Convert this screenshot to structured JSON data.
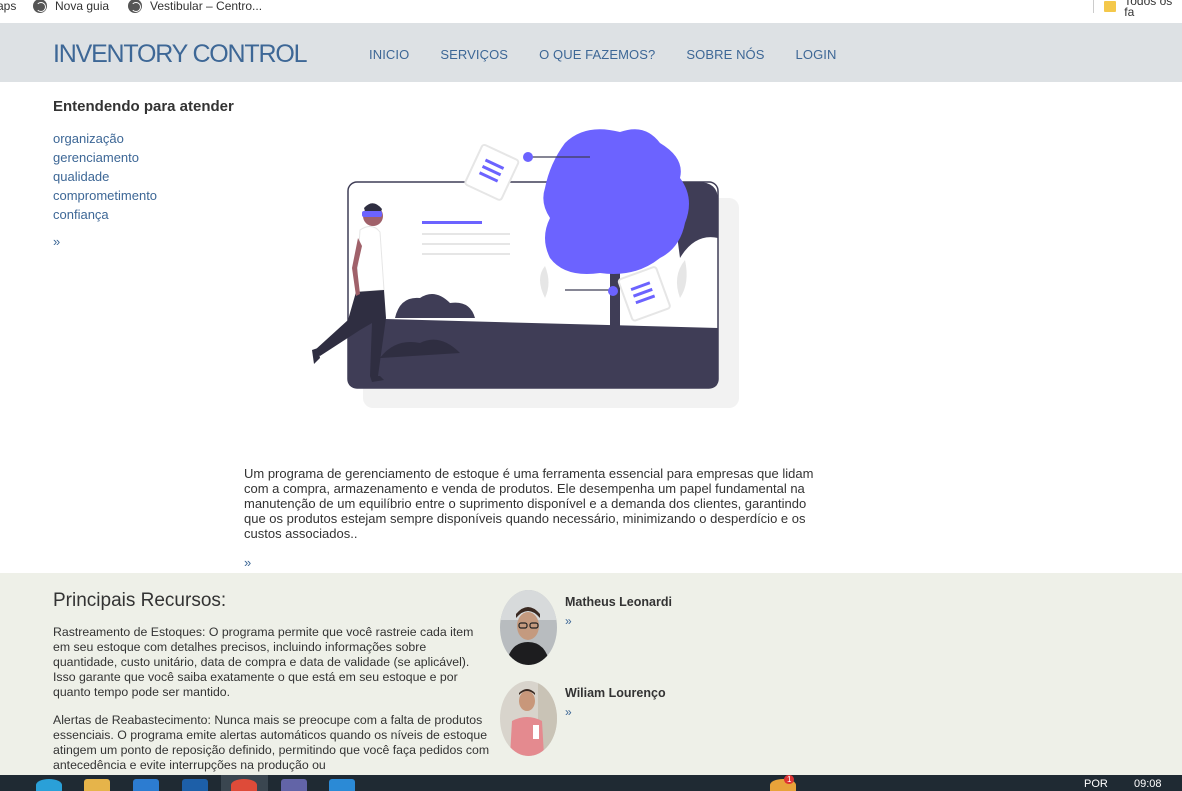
{
  "bookmarks": [
    {
      "label": "aps",
      "icon": "none"
    },
    {
      "label": "Nova guia",
      "icon": "globe-icon"
    },
    {
      "label": "Vestibular – Centro...",
      "icon": "globe-icon"
    },
    {
      "label": "Todos os fa",
      "icon": "folder-icon"
    }
  ],
  "header": {
    "brand": "INVENTORY CONTROL",
    "nav": [
      "INICIO",
      "SERVIÇOS",
      "O QUE FAZEMOS?",
      "SOBRE NÓS",
      "LOGIN"
    ]
  },
  "sidebar": {
    "title": "Entendendo para atender",
    "items": [
      "organização",
      "gerenciamento",
      "qualidade",
      "comprometimento",
      "confiança"
    ],
    "more": "»"
  },
  "main": {
    "description": "Um programa de gerenciamento de estoque é uma ferramenta essencial para empresas que lidam com a compra, armazenamento e venda de produtos. Ele desempenha um papel fundamental na manutenção de um equilíbrio entre o suprimento disponível e a demanda dos clientes, garantindo que os produtos estejam sempre disponíveis quando necessário, minimizando o desperdício e os custos associados..",
    "more": "»"
  },
  "features": {
    "title": "Principais Recursos:",
    "p1": "Rastreamento de Estoques: O programa permite que você rastreie cada item em seu estoque com detalhes precisos, incluindo informações sobre quantidade, custo unitário, data de compra e data de validade (se aplicável). Isso garante que você saiba exatamente o que está em seu estoque e por quanto tempo pode ser mantido.",
    "p2": "Alertas de Reabastecimento: Nunca mais se preocupe com a falta de produtos essenciais. O programa emite alertas automáticos quando os níveis de estoque atingem um ponto de reposição definido, permitindo que você faça pedidos com antecedência e evite interrupções na produção ou"
  },
  "team": [
    {
      "name": "Matheus Leonardi",
      "more": "»"
    },
    {
      "name": "Wiliam Lourenço",
      "more": "»"
    }
  ],
  "taskbar": {
    "lang": "POR",
    "time": "09:08",
    "badge": "1"
  },
  "colors": {
    "brand": "#3d6796",
    "header_bg": "#dde1e4",
    "accent": "#6c63ff",
    "dark": "#3f3d56",
    "lower_bg": "#eef0e8"
  }
}
